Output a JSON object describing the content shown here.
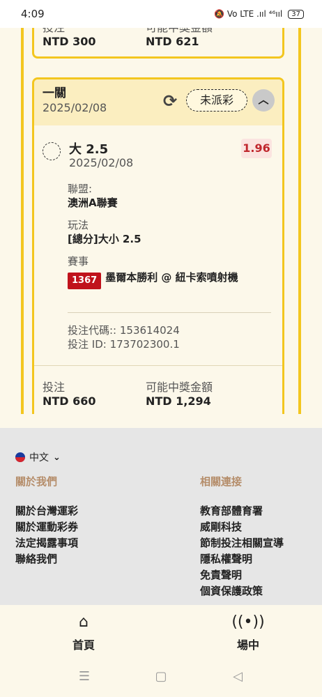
{
  "status_bar": {
    "time": "4:09",
    "icons_text": "🔕 Vo LTE .ııl ⁴⁶ııl",
    "battery": "37"
  },
  "previous_bet": {
    "stake_label": "投注",
    "stake_value": "NTD 300",
    "payout_label": "可能中獎金額",
    "payout_value": "NTD 621"
  },
  "leg_card": {
    "title": "一關",
    "date": "2025/02/08",
    "status_label": "未派彩",
    "selection": {
      "pick": "大 2.5",
      "date": "2025/02/08",
      "odds": "1.96",
      "league_label": "聯盟:",
      "league_value": "澳洲A聯賽",
      "market_label": "玩法",
      "market_value": "[總分]大小 2.5",
      "event_label": "賽事",
      "event_code": "1367",
      "event_name": "墨爾本勝利 @ 紐卡索噴射機",
      "bet_code": "投注代碼:: 153614024",
      "bet_id": "投注 ID: 173702300.1"
    },
    "stake_label": "投注",
    "stake_value": "NTD 660",
    "payout_label": "可能中獎金額",
    "payout_value": "NTD 1,294"
  },
  "footer": {
    "language": "中文",
    "about_heading": "關於我們",
    "about_links": [
      "關於台灣運彩",
      "關於運動彩券",
      "法定揭露事項",
      "聯絡我們"
    ],
    "related_heading": "相關連接",
    "related_links": [
      "教育部體育署",
      "威剛科技",
      "節制投注相關宣導",
      "隱私權聲明",
      "免責聲明",
      "個資保護政策"
    ]
  },
  "bottom_nav": {
    "home_label": "首頁",
    "live_label": "場中"
  },
  "colors": {
    "accent": "#f3c61f",
    "odds": "#c0272d",
    "badge": "#c0121b",
    "heading": "#b58d6a"
  }
}
